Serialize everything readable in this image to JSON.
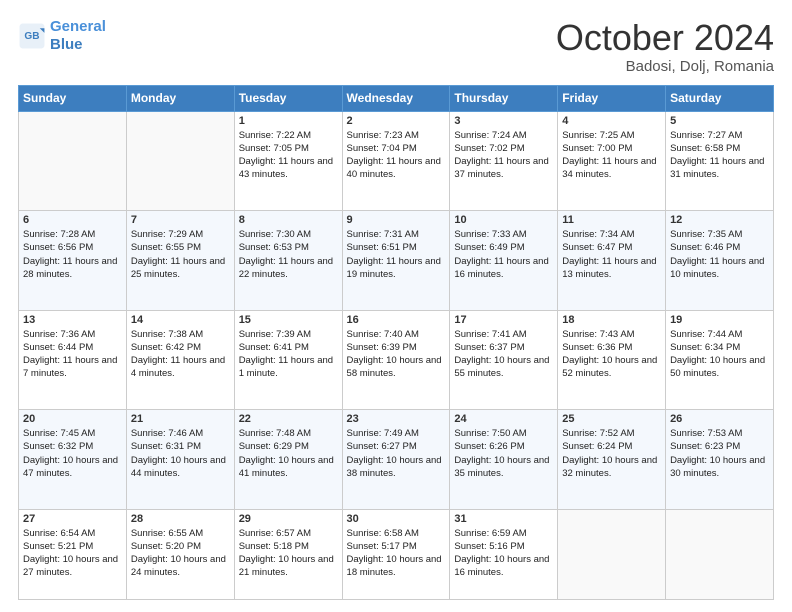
{
  "logo": {
    "line1": "General",
    "line2": "Blue"
  },
  "title": "October 2024",
  "location": "Badosi, Dolj, Romania",
  "weekdays": [
    "Sunday",
    "Monday",
    "Tuesday",
    "Wednesday",
    "Thursday",
    "Friday",
    "Saturday"
  ],
  "weeks": [
    [
      {
        "day": "",
        "info": ""
      },
      {
        "day": "",
        "info": ""
      },
      {
        "day": "1",
        "info": "Sunrise: 7:22 AM\nSunset: 7:05 PM\nDaylight: 11 hours and 43 minutes."
      },
      {
        "day": "2",
        "info": "Sunrise: 7:23 AM\nSunset: 7:04 PM\nDaylight: 11 hours and 40 minutes."
      },
      {
        "day": "3",
        "info": "Sunrise: 7:24 AM\nSunset: 7:02 PM\nDaylight: 11 hours and 37 minutes."
      },
      {
        "day": "4",
        "info": "Sunrise: 7:25 AM\nSunset: 7:00 PM\nDaylight: 11 hours and 34 minutes."
      },
      {
        "day": "5",
        "info": "Sunrise: 7:27 AM\nSunset: 6:58 PM\nDaylight: 11 hours and 31 minutes."
      }
    ],
    [
      {
        "day": "6",
        "info": "Sunrise: 7:28 AM\nSunset: 6:56 PM\nDaylight: 11 hours and 28 minutes."
      },
      {
        "day": "7",
        "info": "Sunrise: 7:29 AM\nSunset: 6:55 PM\nDaylight: 11 hours and 25 minutes."
      },
      {
        "day": "8",
        "info": "Sunrise: 7:30 AM\nSunset: 6:53 PM\nDaylight: 11 hours and 22 minutes."
      },
      {
        "day": "9",
        "info": "Sunrise: 7:31 AM\nSunset: 6:51 PM\nDaylight: 11 hours and 19 minutes."
      },
      {
        "day": "10",
        "info": "Sunrise: 7:33 AM\nSunset: 6:49 PM\nDaylight: 11 hours and 16 minutes."
      },
      {
        "day": "11",
        "info": "Sunrise: 7:34 AM\nSunset: 6:47 PM\nDaylight: 11 hours and 13 minutes."
      },
      {
        "day": "12",
        "info": "Sunrise: 7:35 AM\nSunset: 6:46 PM\nDaylight: 11 hours and 10 minutes."
      }
    ],
    [
      {
        "day": "13",
        "info": "Sunrise: 7:36 AM\nSunset: 6:44 PM\nDaylight: 11 hours and 7 minutes."
      },
      {
        "day": "14",
        "info": "Sunrise: 7:38 AM\nSunset: 6:42 PM\nDaylight: 11 hours and 4 minutes."
      },
      {
        "day": "15",
        "info": "Sunrise: 7:39 AM\nSunset: 6:41 PM\nDaylight: 11 hours and 1 minute."
      },
      {
        "day": "16",
        "info": "Sunrise: 7:40 AM\nSunset: 6:39 PM\nDaylight: 10 hours and 58 minutes."
      },
      {
        "day": "17",
        "info": "Sunrise: 7:41 AM\nSunset: 6:37 PM\nDaylight: 10 hours and 55 minutes."
      },
      {
        "day": "18",
        "info": "Sunrise: 7:43 AM\nSunset: 6:36 PM\nDaylight: 10 hours and 52 minutes."
      },
      {
        "day": "19",
        "info": "Sunrise: 7:44 AM\nSunset: 6:34 PM\nDaylight: 10 hours and 50 minutes."
      }
    ],
    [
      {
        "day": "20",
        "info": "Sunrise: 7:45 AM\nSunset: 6:32 PM\nDaylight: 10 hours and 47 minutes."
      },
      {
        "day": "21",
        "info": "Sunrise: 7:46 AM\nSunset: 6:31 PM\nDaylight: 10 hours and 44 minutes."
      },
      {
        "day": "22",
        "info": "Sunrise: 7:48 AM\nSunset: 6:29 PM\nDaylight: 10 hours and 41 minutes."
      },
      {
        "day": "23",
        "info": "Sunrise: 7:49 AM\nSunset: 6:27 PM\nDaylight: 10 hours and 38 minutes."
      },
      {
        "day": "24",
        "info": "Sunrise: 7:50 AM\nSunset: 6:26 PM\nDaylight: 10 hours and 35 minutes."
      },
      {
        "day": "25",
        "info": "Sunrise: 7:52 AM\nSunset: 6:24 PM\nDaylight: 10 hours and 32 minutes."
      },
      {
        "day": "26",
        "info": "Sunrise: 7:53 AM\nSunset: 6:23 PM\nDaylight: 10 hours and 30 minutes."
      }
    ],
    [
      {
        "day": "27",
        "info": "Sunrise: 6:54 AM\nSunset: 5:21 PM\nDaylight: 10 hours and 27 minutes."
      },
      {
        "day": "28",
        "info": "Sunrise: 6:55 AM\nSunset: 5:20 PM\nDaylight: 10 hours and 24 minutes."
      },
      {
        "day": "29",
        "info": "Sunrise: 6:57 AM\nSunset: 5:18 PM\nDaylight: 10 hours and 21 minutes."
      },
      {
        "day": "30",
        "info": "Sunrise: 6:58 AM\nSunset: 5:17 PM\nDaylight: 10 hours and 18 minutes."
      },
      {
        "day": "31",
        "info": "Sunrise: 6:59 AM\nSunset: 5:16 PM\nDaylight: 10 hours and 16 minutes."
      },
      {
        "day": "",
        "info": ""
      },
      {
        "day": "",
        "info": ""
      }
    ]
  ]
}
